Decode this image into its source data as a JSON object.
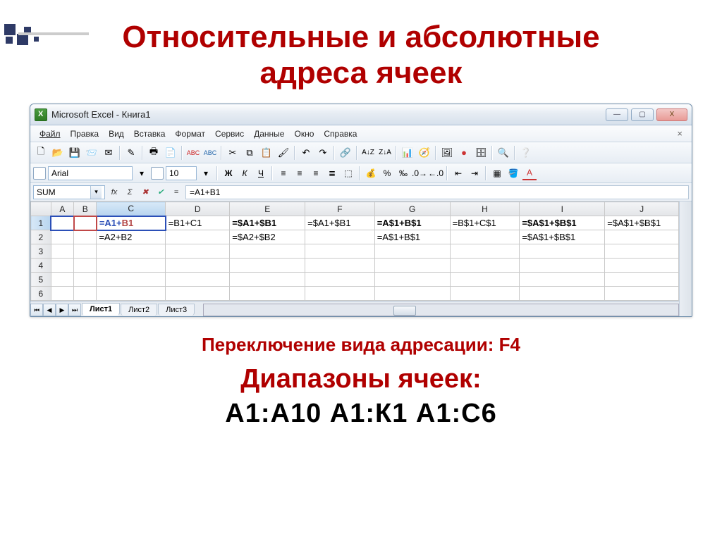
{
  "slide": {
    "title_line1": "Относительные и абсолютные",
    "title_line2": "адреса ячеек",
    "sub1": "Переключение вида адресации:  F4",
    "sub2": "Диапазоны ячеек:",
    "sub3": "А1:А10     А1:К1     А1:С6"
  },
  "window": {
    "title": "Microsoft Excel - Книга1"
  },
  "menu": {
    "items": [
      "Файл",
      "Правка",
      "Вид",
      "Вставка",
      "Формат",
      "Сервис",
      "Данные",
      "Окно",
      "Справка"
    ]
  },
  "format": {
    "font": "Arial",
    "size": "10"
  },
  "formula": {
    "name_box": "SUM",
    "input": "=A1+B1"
  },
  "grid": {
    "columns": [
      "A",
      "B",
      "C",
      "D",
      "E",
      "F",
      "G",
      "H",
      "I",
      "J"
    ],
    "rows": [
      "1",
      "2",
      "3",
      "4",
      "5",
      "6"
    ],
    "cells": {
      "r1": {
        "C": "=A1+B1",
        "D": "=B1+C1",
        "E": "=$A1+$B1",
        "F": "=$A1+$B1",
        "G": "=A$1+B$1",
        "H": "=B$1+C$1",
        "I": "=$A$1+$B$1",
        "J": "=$A$1+$B$1"
      },
      "r2": {
        "C": "=A2+B2",
        "E": "=$A2+$B2",
        "G": "=A$1+B$1",
        "I": "=$A$1+$B$1"
      }
    }
  },
  "tabs": {
    "sheets": [
      "Лист1",
      "Лист2",
      "Лист3"
    ]
  },
  "icons": {
    "min": "—",
    "max": "▢",
    "close": "X",
    "dd": "▾",
    "fx": "fx",
    "x": "✖",
    "check": "✔"
  }
}
